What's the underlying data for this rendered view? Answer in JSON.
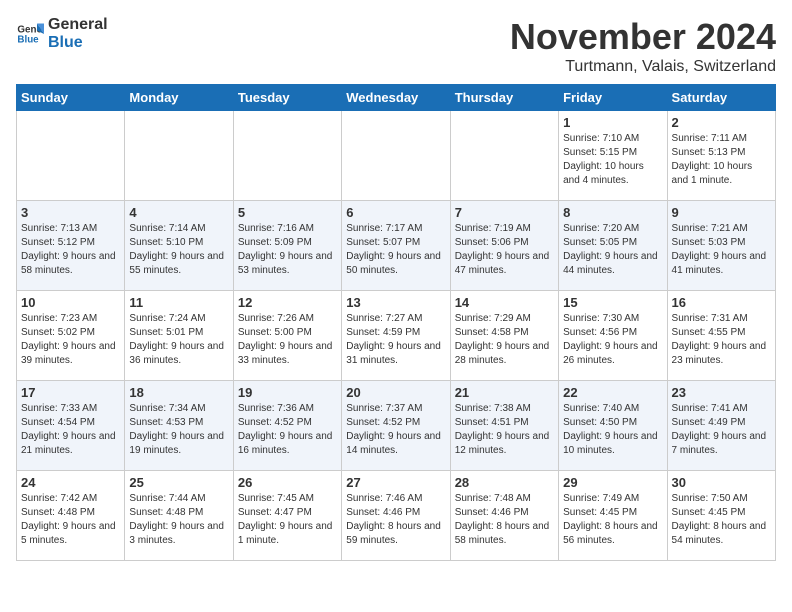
{
  "header": {
    "logo_general": "General",
    "logo_blue": "Blue",
    "month": "November 2024",
    "location": "Turtmann, Valais, Switzerland"
  },
  "days_of_week": [
    "Sunday",
    "Monday",
    "Tuesday",
    "Wednesday",
    "Thursday",
    "Friday",
    "Saturday"
  ],
  "weeks": [
    [
      {
        "day": "",
        "info": ""
      },
      {
        "day": "",
        "info": ""
      },
      {
        "day": "",
        "info": ""
      },
      {
        "day": "",
        "info": ""
      },
      {
        "day": "",
        "info": ""
      },
      {
        "day": "1",
        "info": "Sunrise: 7:10 AM\nSunset: 5:15 PM\nDaylight: 10 hours and 4 minutes."
      },
      {
        "day": "2",
        "info": "Sunrise: 7:11 AM\nSunset: 5:13 PM\nDaylight: 10 hours and 1 minute."
      }
    ],
    [
      {
        "day": "3",
        "info": "Sunrise: 7:13 AM\nSunset: 5:12 PM\nDaylight: 9 hours and 58 minutes."
      },
      {
        "day": "4",
        "info": "Sunrise: 7:14 AM\nSunset: 5:10 PM\nDaylight: 9 hours and 55 minutes."
      },
      {
        "day": "5",
        "info": "Sunrise: 7:16 AM\nSunset: 5:09 PM\nDaylight: 9 hours and 53 minutes."
      },
      {
        "day": "6",
        "info": "Sunrise: 7:17 AM\nSunset: 5:07 PM\nDaylight: 9 hours and 50 minutes."
      },
      {
        "day": "7",
        "info": "Sunrise: 7:19 AM\nSunset: 5:06 PM\nDaylight: 9 hours and 47 minutes."
      },
      {
        "day": "8",
        "info": "Sunrise: 7:20 AM\nSunset: 5:05 PM\nDaylight: 9 hours and 44 minutes."
      },
      {
        "day": "9",
        "info": "Sunrise: 7:21 AM\nSunset: 5:03 PM\nDaylight: 9 hours and 41 minutes."
      }
    ],
    [
      {
        "day": "10",
        "info": "Sunrise: 7:23 AM\nSunset: 5:02 PM\nDaylight: 9 hours and 39 minutes."
      },
      {
        "day": "11",
        "info": "Sunrise: 7:24 AM\nSunset: 5:01 PM\nDaylight: 9 hours and 36 minutes."
      },
      {
        "day": "12",
        "info": "Sunrise: 7:26 AM\nSunset: 5:00 PM\nDaylight: 9 hours and 33 minutes."
      },
      {
        "day": "13",
        "info": "Sunrise: 7:27 AM\nSunset: 4:59 PM\nDaylight: 9 hours and 31 minutes."
      },
      {
        "day": "14",
        "info": "Sunrise: 7:29 AM\nSunset: 4:58 PM\nDaylight: 9 hours and 28 minutes."
      },
      {
        "day": "15",
        "info": "Sunrise: 7:30 AM\nSunset: 4:56 PM\nDaylight: 9 hours and 26 minutes."
      },
      {
        "day": "16",
        "info": "Sunrise: 7:31 AM\nSunset: 4:55 PM\nDaylight: 9 hours and 23 minutes."
      }
    ],
    [
      {
        "day": "17",
        "info": "Sunrise: 7:33 AM\nSunset: 4:54 PM\nDaylight: 9 hours and 21 minutes."
      },
      {
        "day": "18",
        "info": "Sunrise: 7:34 AM\nSunset: 4:53 PM\nDaylight: 9 hours and 19 minutes."
      },
      {
        "day": "19",
        "info": "Sunrise: 7:36 AM\nSunset: 4:52 PM\nDaylight: 9 hours and 16 minutes."
      },
      {
        "day": "20",
        "info": "Sunrise: 7:37 AM\nSunset: 4:52 PM\nDaylight: 9 hours and 14 minutes."
      },
      {
        "day": "21",
        "info": "Sunrise: 7:38 AM\nSunset: 4:51 PM\nDaylight: 9 hours and 12 minutes."
      },
      {
        "day": "22",
        "info": "Sunrise: 7:40 AM\nSunset: 4:50 PM\nDaylight: 9 hours and 10 minutes."
      },
      {
        "day": "23",
        "info": "Sunrise: 7:41 AM\nSunset: 4:49 PM\nDaylight: 9 hours and 7 minutes."
      }
    ],
    [
      {
        "day": "24",
        "info": "Sunrise: 7:42 AM\nSunset: 4:48 PM\nDaylight: 9 hours and 5 minutes."
      },
      {
        "day": "25",
        "info": "Sunrise: 7:44 AM\nSunset: 4:48 PM\nDaylight: 9 hours and 3 minutes."
      },
      {
        "day": "26",
        "info": "Sunrise: 7:45 AM\nSunset: 4:47 PM\nDaylight: 9 hours and 1 minute."
      },
      {
        "day": "27",
        "info": "Sunrise: 7:46 AM\nSunset: 4:46 PM\nDaylight: 8 hours and 59 minutes."
      },
      {
        "day": "28",
        "info": "Sunrise: 7:48 AM\nSunset: 4:46 PM\nDaylight: 8 hours and 58 minutes."
      },
      {
        "day": "29",
        "info": "Sunrise: 7:49 AM\nSunset: 4:45 PM\nDaylight: 8 hours and 56 minutes."
      },
      {
        "day": "30",
        "info": "Sunrise: 7:50 AM\nSunset: 4:45 PM\nDaylight: 8 hours and 54 minutes."
      }
    ]
  ]
}
